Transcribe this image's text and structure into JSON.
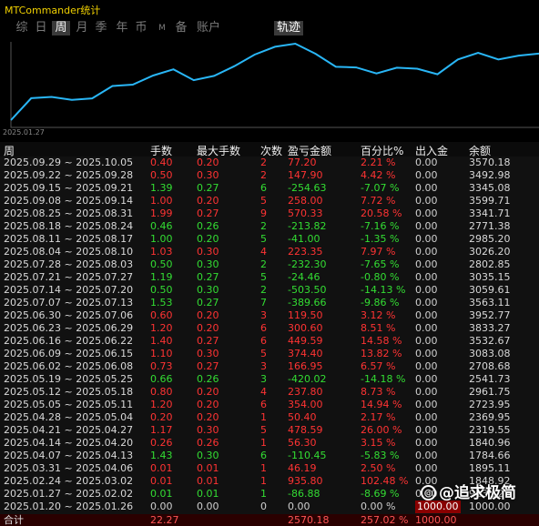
{
  "window": {
    "title": "MTCommander统计"
  },
  "periods": [
    "综",
    "日",
    "周",
    "月",
    "季",
    "年",
    "币",
    "M",
    "备",
    "账户"
  ],
  "active_period": "周",
  "track_tab": "轨迹",
  "chart": {
    "start_date_label": "2025.01.27",
    "line_color": "#29b6f6",
    "balance_series": [
      1000.0,
      1848.92,
      1895.11,
      1784.66,
      1840.96,
      2319.55,
      2369.95,
      2723.95,
      2961.75,
      2541.73,
      2708.68,
      3083.08,
      3532.67,
      3833.27,
      3952.77,
      3563.11,
      3059.61,
      3035.15,
      2802.85,
      3026.2,
      2985.2,
      2771.38,
      3341.71,
      3599.71,
      3345.08,
      3492.98,
      3570.18
    ]
  },
  "table": {
    "headers": {
      "week": "周",
      "lots": "手数",
      "max_lots": "最大手数",
      "count": "次数",
      "pnl": "盈亏金额",
      "percent": "百分比%",
      "flow": "出入金",
      "balance": "余额"
    },
    "rows": [
      {
        "week": "2025.09.29 ~ 2025.10.05",
        "lots": "0.40",
        "max_lots": "0.20",
        "count": "2",
        "pnl": "77.20",
        "percent": "2.21 %",
        "flow": "0.00",
        "balance": "3570.18",
        "sign": "neg"
      },
      {
        "week": "2025.09.22 ~ 2025.09.28",
        "lots": "0.50",
        "max_lots": "0.30",
        "count": "2",
        "pnl": "147.90",
        "percent": "4.42 %",
        "flow": "0.00",
        "balance": "3492.98",
        "sign": "neg"
      },
      {
        "week": "2025.09.15 ~ 2025.09.21",
        "lots": "1.39",
        "max_lots": "0.27",
        "count": "6",
        "pnl": "-254.63",
        "percent": "-7.07 %",
        "flow": "0.00",
        "balance": "3345.08",
        "sign": "pos"
      },
      {
        "week": "2025.09.08 ~ 2025.09.14",
        "lots": "1.00",
        "max_lots": "0.20",
        "count": "5",
        "pnl": "258.00",
        "percent": "7.72 %",
        "flow": "0.00",
        "balance": "3599.71",
        "sign": "neg"
      },
      {
        "week": "2025.08.25 ~ 2025.08.31",
        "lots": "1.99",
        "max_lots": "0.27",
        "count": "9",
        "pnl": "570.33",
        "percent": "20.58 %",
        "flow": "0.00",
        "balance": "3341.71",
        "sign": "neg"
      },
      {
        "week": "2025.08.18 ~ 2025.08.24",
        "lots": "0.46",
        "max_lots": "0.26",
        "count": "2",
        "pnl": "-213.82",
        "percent": "-7.16 %",
        "flow": "0.00",
        "balance": "2771.38",
        "sign": "pos"
      },
      {
        "week": "2025.08.11 ~ 2025.08.17",
        "lots": "1.00",
        "max_lots": "0.20",
        "count": "5",
        "pnl": "-41.00",
        "percent": "-1.35 %",
        "flow": "0.00",
        "balance": "2985.20",
        "sign": "pos"
      },
      {
        "week": "2025.08.04 ~ 2025.08.10",
        "lots": "1.03",
        "max_lots": "0.30",
        "count": "4",
        "pnl": "223.35",
        "percent": "7.97 %",
        "flow": "0.00",
        "balance": "3026.20",
        "sign": "neg"
      },
      {
        "week": "2025.07.28 ~ 2025.08.03",
        "lots": "0.50",
        "max_lots": "0.30",
        "count": "2",
        "pnl": "-232.30",
        "percent": "-7.65 %",
        "flow": "0.00",
        "balance": "2802.85",
        "sign": "pos"
      },
      {
        "week": "2025.07.21 ~ 2025.07.27",
        "lots": "1.19",
        "max_lots": "0.27",
        "count": "5",
        "pnl": "-24.46",
        "percent": "-0.80 %",
        "flow": "0.00",
        "balance": "3035.15",
        "sign": "pos"
      },
      {
        "week": "2025.07.14 ~ 2025.07.20",
        "lots": "0.50",
        "max_lots": "0.30",
        "count": "2",
        "pnl": "-503.50",
        "percent": "-14.13 %",
        "flow": "0.00",
        "balance": "3059.61",
        "sign": "pos"
      },
      {
        "week": "2025.07.07 ~ 2025.07.13",
        "lots": "1.53",
        "max_lots": "0.27",
        "count": "7",
        "pnl": "-389.66",
        "percent": "-9.86 %",
        "flow": "0.00",
        "balance": "3563.11",
        "sign": "pos"
      },
      {
        "week": "2025.06.30 ~ 2025.07.06",
        "lots": "0.60",
        "max_lots": "0.20",
        "count": "3",
        "pnl": "119.50",
        "percent": "3.12 %",
        "flow": "0.00",
        "balance": "3952.77",
        "sign": "neg"
      },
      {
        "week": "2025.06.23 ~ 2025.06.29",
        "lots": "1.20",
        "max_lots": "0.20",
        "count": "6",
        "pnl": "300.60",
        "percent": "8.51 %",
        "flow": "0.00",
        "balance": "3833.27",
        "sign": "neg"
      },
      {
        "week": "2025.06.16 ~ 2025.06.22",
        "lots": "1.40",
        "max_lots": "0.27",
        "count": "6",
        "pnl": "449.59",
        "percent": "14.58 %",
        "flow": "0.00",
        "balance": "3532.67",
        "sign": "neg"
      },
      {
        "week": "2025.06.09 ~ 2025.06.15",
        "lots": "1.10",
        "max_lots": "0.30",
        "count": "5",
        "pnl": "374.40",
        "percent": "13.82 %",
        "flow": "0.00",
        "balance": "3083.08",
        "sign": "neg"
      },
      {
        "week": "2025.06.02 ~ 2025.06.08",
        "lots": "0.73",
        "max_lots": "0.27",
        "count": "3",
        "pnl": "166.95",
        "percent": "6.57 %",
        "flow": "0.00",
        "balance": "2708.68",
        "sign": "neg"
      },
      {
        "week": "2025.05.19 ~ 2025.05.25",
        "lots": "0.66",
        "max_lots": "0.26",
        "count": "3",
        "pnl": "-420.02",
        "percent": "-14.18 %",
        "flow": "0.00",
        "balance": "2541.73",
        "sign": "pos"
      },
      {
        "week": "2025.05.12 ~ 2025.05.18",
        "lots": "0.80",
        "max_lots": "0.20",
        "count": "4",
        "pnl": "237.80",
        "percent": "8.73 %",
        "flow": "0.00",
        "balance": "2961.75",
        "sign": "neg"
      },
      {
        "week": "2025.05.05 ~ 2025.05.11",
        "lots": "1.20",
        "max_lots": "0.20",
        "count": "6",
        "pnl": "354.00",
        "percent": "14.94 %",
        "flow": "0.00",
        "balance": "2723.95",
        "sign": "neg"
      },
      {
        "week": "2025.04.28 ~ 2025.05.04",
        "lots": "0.20",
        "max_lots": "0.20",
        "count": "1",
        "pnl": "50.40",
        "percent": "2.17 %",
        "flow": "0.00",
        "balance": "2369.95",
        "sign": "neg"
      },
      {
        "week": "2025.04.21 ~ 2025.04.27",
        "lots": "1.17",
        "max_lots": "0.30",
        "count": "5",
        "pnl": "478.59",
        "percent": "26.00 %",
        "flow": "0.00",
        "balance": "2319.55",
        "sign": "neg"
      },
      {
        "week": "2025.04.14 ~ 2025.04.20",
        "lots": "0.26",
        "max_lots": "0.26",
        "count": "1",
        "pnl": "56.30",
        "percent": "3.15 %",
        "flow": "0.00",
        "balance": "1840.96",
        "sign": "neg"
      },
      {
        "week": "2025.04.07 ~ 2025.04.13",
        "lots": "1.43",
        "max_lots": "0.30",
        "count": "6",
        "pnl": "-110.45",
        "percent": "-5.83 %",
        "flow": "0.00",
        "balance": "1784.66",
        "sign": "pos"
      },
      {
        "week": "2025.03.31 ~ 2025.04.06",
        "lots": "0.01",
        "max_lots": "0.01",
        "count": "1",
        "pnl": "46.19",
        "percent": "2.50 %",
        "flow": "0.00",
        "balance": "1895.11",
        "sign": "neg"
      },
      {
        "week": "2025.02.24 ~ 2025.03.02",
        "lots": "0.01",
        "max_lots": "0.01",
        "count": "1",
        "pnl": "935.80",
        "percent": "102.48 %",
        "flow": "0.00",
        "balance": "1848.92",
        "sign": "neg"
      },
      {
        "week": "2025.01.27 ~ 2025.02.02",
        "lots": "0.01",
        "max_lots": "0.01",
        "count": "1",
        "pnl": "-86.88",
        "percent": "-8.69 %",
        "flow": "0.00",
        "balance": "913.12",
        "sign": "pos"
      },
      {
        "week": "2025.01.20 ~ 2025.01.26",
        "lots": "0.00",
        "max_lots": "0.00",
        "count": "0",
        "pnl": "0.00",
        "percent": "0.00 %",
        "flow": "1000.00",
        "balance": "1000.00",
        "sign": "zero"
      }
    ],
    "total": {
      "label": "合计",
      "lots": "22.27",
      "pnl": "2570.18",
      "percent": "257.02 %",
      "flow": "1000.00"
    }
  },
  "watermark": {
    "text": "@追求极简"
  }
}
